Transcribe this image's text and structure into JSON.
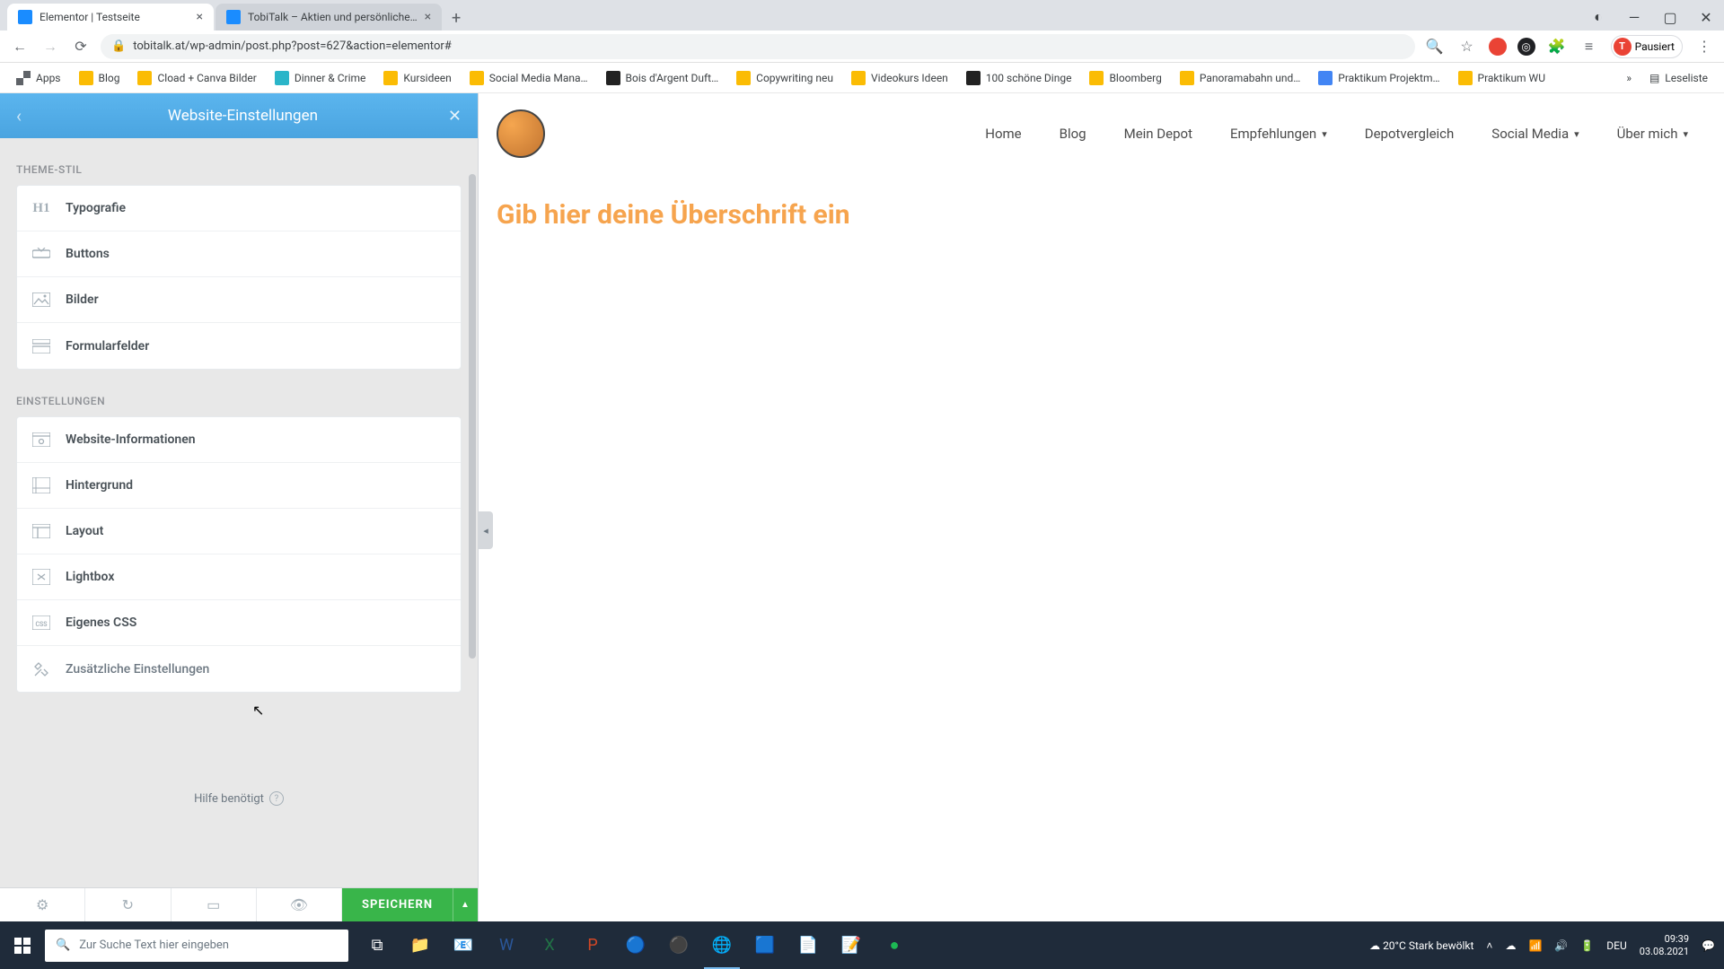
{
  "browser": {
    "tabs": [
      {
        "title": "Elementor | Testseite",
        "active": true
      },
      {
        "title": "TobiTalk – Aktien und persönliche…",
        "active": false
      }
    ],
    "url": "tobitalk.at/wp-admin/post.php?post=627&action=elementor#",
    "profile_label": "Pausiert",
    "profile_initial": "T",
    "bookmarks": [
      "Apps",
      "Blog",
      "Cload + Canva Bilder",
      "Dinner & Crime",
      "Kursideen",
      "Social Media Mana…",
      "Bois d'Argent Duft…",
      "Copywriting neu",
      "Videokurs Ideen",
      "100 schöne Dinge",
      "Bloomberg",
      "Panoramabahn und…",
      "Praktikum Projektm…",
      "Praktikum WU"
    ],
    "reading_list": "Leseliste"
  },
  "elementor": {
    "header_title": "Website-Einstellungen",
    "sections": [
      {
        "label": "THEME-STIL",
        "items": [
          "Typografie",
          "Buttons",
          "Bilder",
          "Formularfelder"
        ]
      },
      {
        "label": "EINSTELLUNGEN",
        "items": [
          "Website-Informationen",
          "Hintergrund",
          "Layout",
          "Lightbox",
          "Eigenes CSS",
          "Zusätzliche Einstellungen"
        ]
      }
    ],
    "help_label": "Hilfe benötigt",
    "save_label": "SPEICHERN"
  },
  "preview": {
    "nav": [
      "Home",
      "Blog",
      "Mein Depot",
      "Empfehlungen",
      "Depotvergleich",
      "Social Media",
      "Über mich"
    ],
    "nav_dropdown_idx": [
      3,
      5,
      6
    ],
    "heading": "Gib hier deine Überschrift ein"
  },
  "taskbar": {
    "search_placeholder": "Zur Suche Text hier eingeben",
    "weather": "20°C  Stark bewölkt",
    "lang": "DEU",
    "time": "09:39",
    "date": "03.08.2021"
  }
}
